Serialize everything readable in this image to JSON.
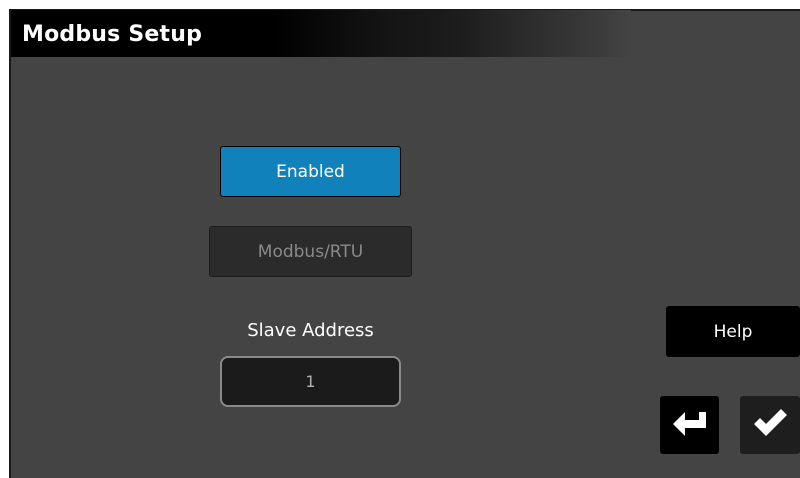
{
  "header": {
    "title": "Modbus Setup"
  },
  "modbus": {
    "enable_label": "Enabled",
    "protocol_label": "Modbus/RTU",
    "slave_address_label": "Slave Address",
    "slave_address_value": "1"
  },
  "actions": {
    "help_label": "Help",
    "back_icon": "enter-return-icon",
    "confirm_icon": "checkmark-icon"
  },
  "colors": {
    "background": "#444444",
    "accent": "#1181bb",
    "title_bar": "#000000"
  }
}
